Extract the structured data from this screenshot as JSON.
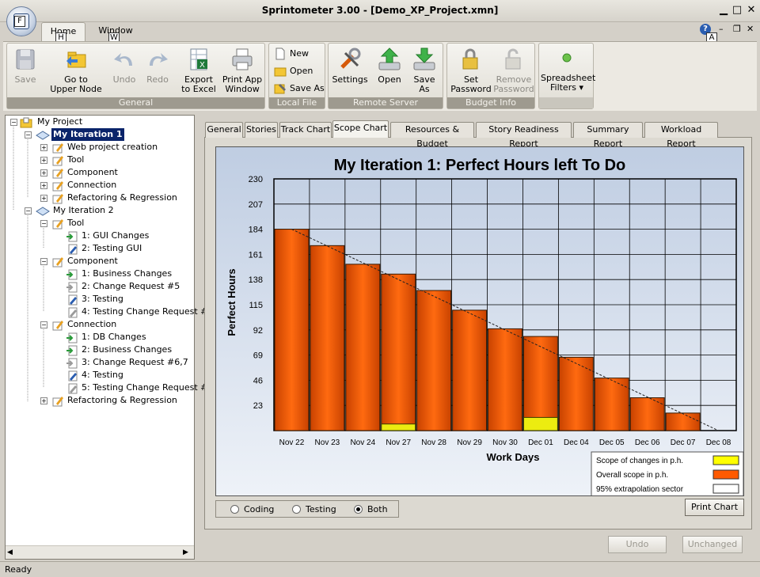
{
  "window": {
    "title": "Sprintometer 3.00 - [Demo_XP_Project.xmn]"
  },
  "app_button": {
    "keytip": "F"
  },
  "ribbon_tabs": [
    {
      "label": "Home",
      "keytip": "H"
    },
    {
      "label": "Window",
      "keytip": "W"
    }
  ],
  "help_keytip": "A",
  "ribbon": {
    "general": {
      "label": "General",
      "save": "Save",
      "go_up_1": "Go to",
      "go_up_2": "Upper Node",
      "undo": "Undo",
      "redo": "Redo",
      "export_1": "Export",
      "export_2": "to Excel",
      "print_1": "Print App",
      "print_2": "Window"
    },
    "local_file": {
      "label": "Local File",
      "new": "New",
      "open": "Open",
      "save_as": "Save As"
    },
    "remote_server": {
      "label": "Remote Server",
      "settings": "Settings",
      "open": "Open",
      "save_1": "Save",
      "save_2": "As"
    },
    "budget_info": {
      "label": "Budget Info",
      "set_pw_1": "Set",
      "set_pw_2": "Password",
      "rm_pw_1": "Remove",
      "rm_pw_2": "Password"
    },
    "spreadsheet": {
      "label_1": "Spreadsheet",
      "label_2": "Filters"
    }
  },
  "tree": {
    "project": "My Project",
    "iter1": {
      "label": "My Iteration 1",
      "children": [
        "Web project creation",
        "Tool",
        "Component",
        "Connection",
        "Refactoring & Regression"
      ]
    },
    "iter2": {
      "label": "My Iteration 2",
      "tool": {
        "label": "Tool",
        "items": [
          "1: GUI Changes",
          "2: Testing GUI"
        ]
      },
      "component": {
        "label": "Component",
        "items": [
          "1: Business Changes",
          "2: Change Request #5",
          "3: Testing",
          "4: Testing Change Request #"
        ]
      },
      "connection": {
        "label": "Connection",
        "items": [
          "1: DB Changes",
          "2: Business Changes",
          "3: Change Request #6,7",
          "4: Testing",
          "5: Testing Change Request #"
        ]
      },
      "refactoring": "Refactoring & Regression"
    }
  },
  "content_tabs": [
    "General",
    "Stories",
    "Track Chart",
    "Scope Chart",
    "Resources & Budget",
    "Story Readiness Report",
    "Summary Report",
    "Workload Report"
  ],
  "selected_tab": "Scope Chart",
  "chart_data": {
    "type": "bar",
    "title": "My Iteration 1: Perfect Hours left To Do",
    "xlabel": "Work Days",
    "ylabel": "Perfect Hours",
    "ylim": [
      0,
      230
    ],
    "yticks": [
      23,
      46,
      69,
      92,
      115,
      138,
      161,
      184,
      207,
      230
    ],
    "categories": [
      "Nov 22",
      "Nov 23",
      "Nov 24",
      "Nov 27",
      "Nov 28",
      "Nov 29",
      "Nov 30",
      "Dec 01",
      "Dec 04",
      "Dec 05",
      "Dec 06",
      "Dec 07",
      "Dec 08"
    ],
    "series": [
      {
        "name": "Overall scope in p.h.",
        "color": "#f05a00",
        "values": [
          184,
          169,
          152,
          143,
          128,
          110,
          93,
          86,
          67,
          48,
          30,
          16,
          0
        ]
      },
      {
        "name": "Scope of changes in p.h.",
        "color": "#f0f000",
        "values": [
          0,
          0,
          0,
          6,
          0,
          0,
          0,
          12,
          0,
          0,
          0,
          0,
          0
        ]
      }
    ],
    "trend": {
      "name": "95% extrapolation sector",
      "from": 184,
      "to": 0
    },
    "legend": [
      {
        "label": "Scope of changes in p.h.",
        "color": "#ffff00"
      },
      {
        "label": "Overall scope in p.h.",
        "color": "#ff5a00"
      },
      {
        "label": "95% extrapolation sector",
        "color": "#ffffff"
      }
    ],
    "grid": true
  },
  "mode_radios": [
    {
      "label": "Coding",
      "checked": false
    },
    {
      "label": "Testing",
      "checked": false
    },
    {
      "label": "Both",
      "checked": true
    }
  ],
  "buttons": {
    "print_chart": "Print Chart",
    "undo": "Undo",
    "unchanged": "Unchanged"
  },
  "status": "Ready"
}
